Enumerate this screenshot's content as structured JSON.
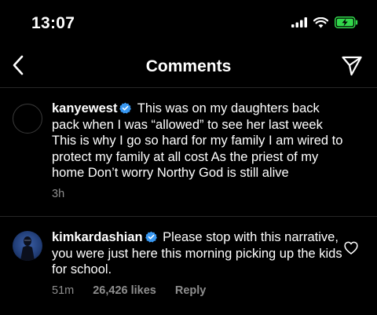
{
  "status_bar": {
    "time": "13:07",
    "icons": [
      "signal-icon",
      "wifi-icon",
      "battery-charging-icon"
    ],
    "battery_color": "#32d74b"
  },
  "header": {
    "title": "Comments",
    "back_icon": "chevron-left-icon",
    "share_icon": "send-icon"
  },
  "comments": [
    {
      "username": "kanyewest",
      "verified": true,
      "text": "This was on my daughters back pack when I was “allowed” to see her last week This is why I go so hard for my family  I am wired to protect my family at all cost  As the priest of my home  Don’t worry Northy  God is still alive",
      "time": "3h"
    },
    {
      "username": "kimkardashian",
      "verified": true,
      "text": "Please stop with this narrative, you were just here this morning picking up the kids for school.",
      "time": "51m",
      "likes": "26,426 likes",
      "reply_label": "Reply"
    }
  ],
  "colors": {
    "background": "#000000",
    "text": "#ffffff",
    "secondary_text": "#8e8e8e",
    "verified_badge": "#3897f0",
    "divider": "#262626"
  }
}
